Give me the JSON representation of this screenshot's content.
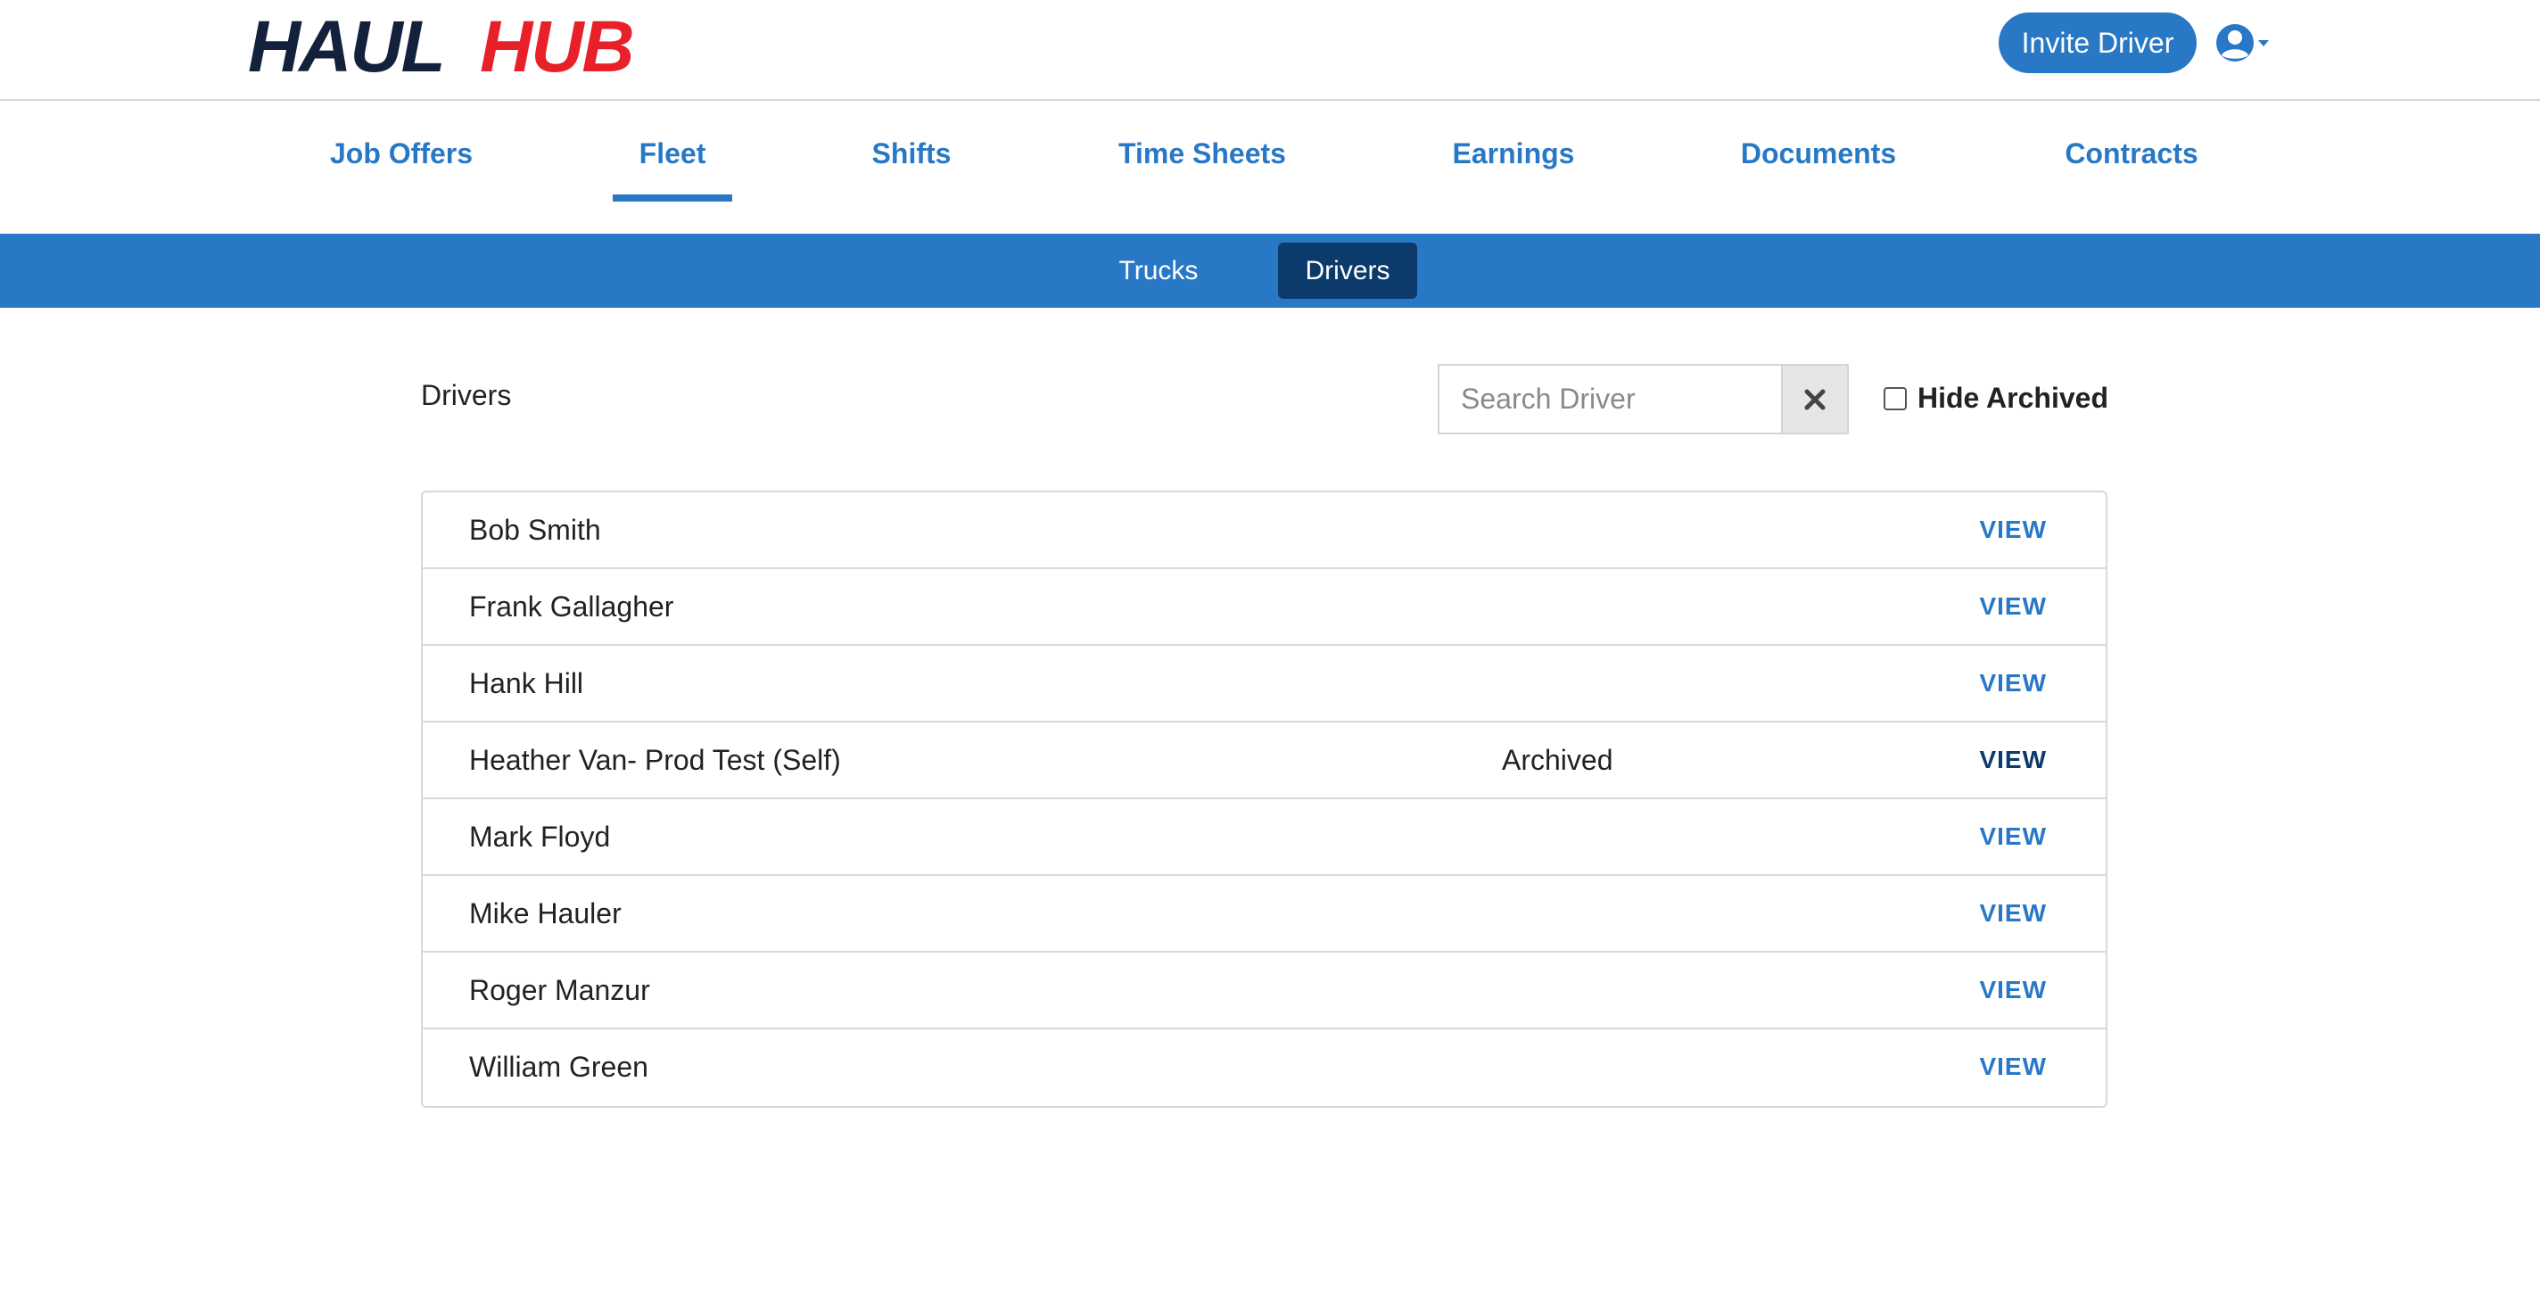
{
  "brand": {
    "logo_part1": "HAUL",
    "logo_part2": "HUB",
    "dark_color": "#14213d",
    "red_color": "#e8202a"
  },
  "header": {
    "invite_label": "Invite Driver",
    "user_icon": "user-circle-icon"
  },
  "nav": {
    "items": [
      {
        "label": "Job Offers"
      },
      {
        "label": "Fleet"
      },
      {
        "label": "Shifts"
      },
      {
        "label": "Time Sheets"
      },
      {
        "label": "Earnings"
      },
      {
        "label": "Documents"
      },
      {
        "label": "Contracts"
      }
    ],
    "active": "Fleet"
  },
  "subnav": {
    "items": [
      {
        "label": "Trucks"
      },
      {
        "label": "Drivers"
      }
    ],
    "active": "Drivers"
  },
  "toolbar": {
    "title": "Drivers",
    "search_placeholder": "Search Driver",
    "search_value": "",
    "clear_icon": "times-icon",
    "hide_archived_label": "Hide Archived",
    "hide_archived_checked": false
  },
  "drivers": [
    {
      "name": "Bob Smith",
      "status": "",
      "action": "VIEW"
    },
    {
      "name": "Frank Gallagher",
      "status": "",
      "action": "VIEW"
    },
    {
      "name": "Hank Hill",
      "status": "",
      "action": "VIEW"
    },
    {
      "name": "Heather Van- Prod Test (Self)",
      "status": "Archived",
      "action": "VIEW"
    },
    {
      "name": "Mark Floyd",
      "status": "",
      "action": "VIEW"
    },
    {
      "name": "Mike Hauler",
      "status": "",
      "action": "VIEW"
    },
    {
      "name": "Roger Manzur",
      "status": "",
      "action": "VIEW"
    },
    {
      "name": "William Green",
      "status": "",
      "action": "VIEW"
    }
  ],
  "colors": {
    "primary": "#2878c6",
    "primary_dark": "#0b3a6b",
    "border": "#d9d9d9"
  }
}
